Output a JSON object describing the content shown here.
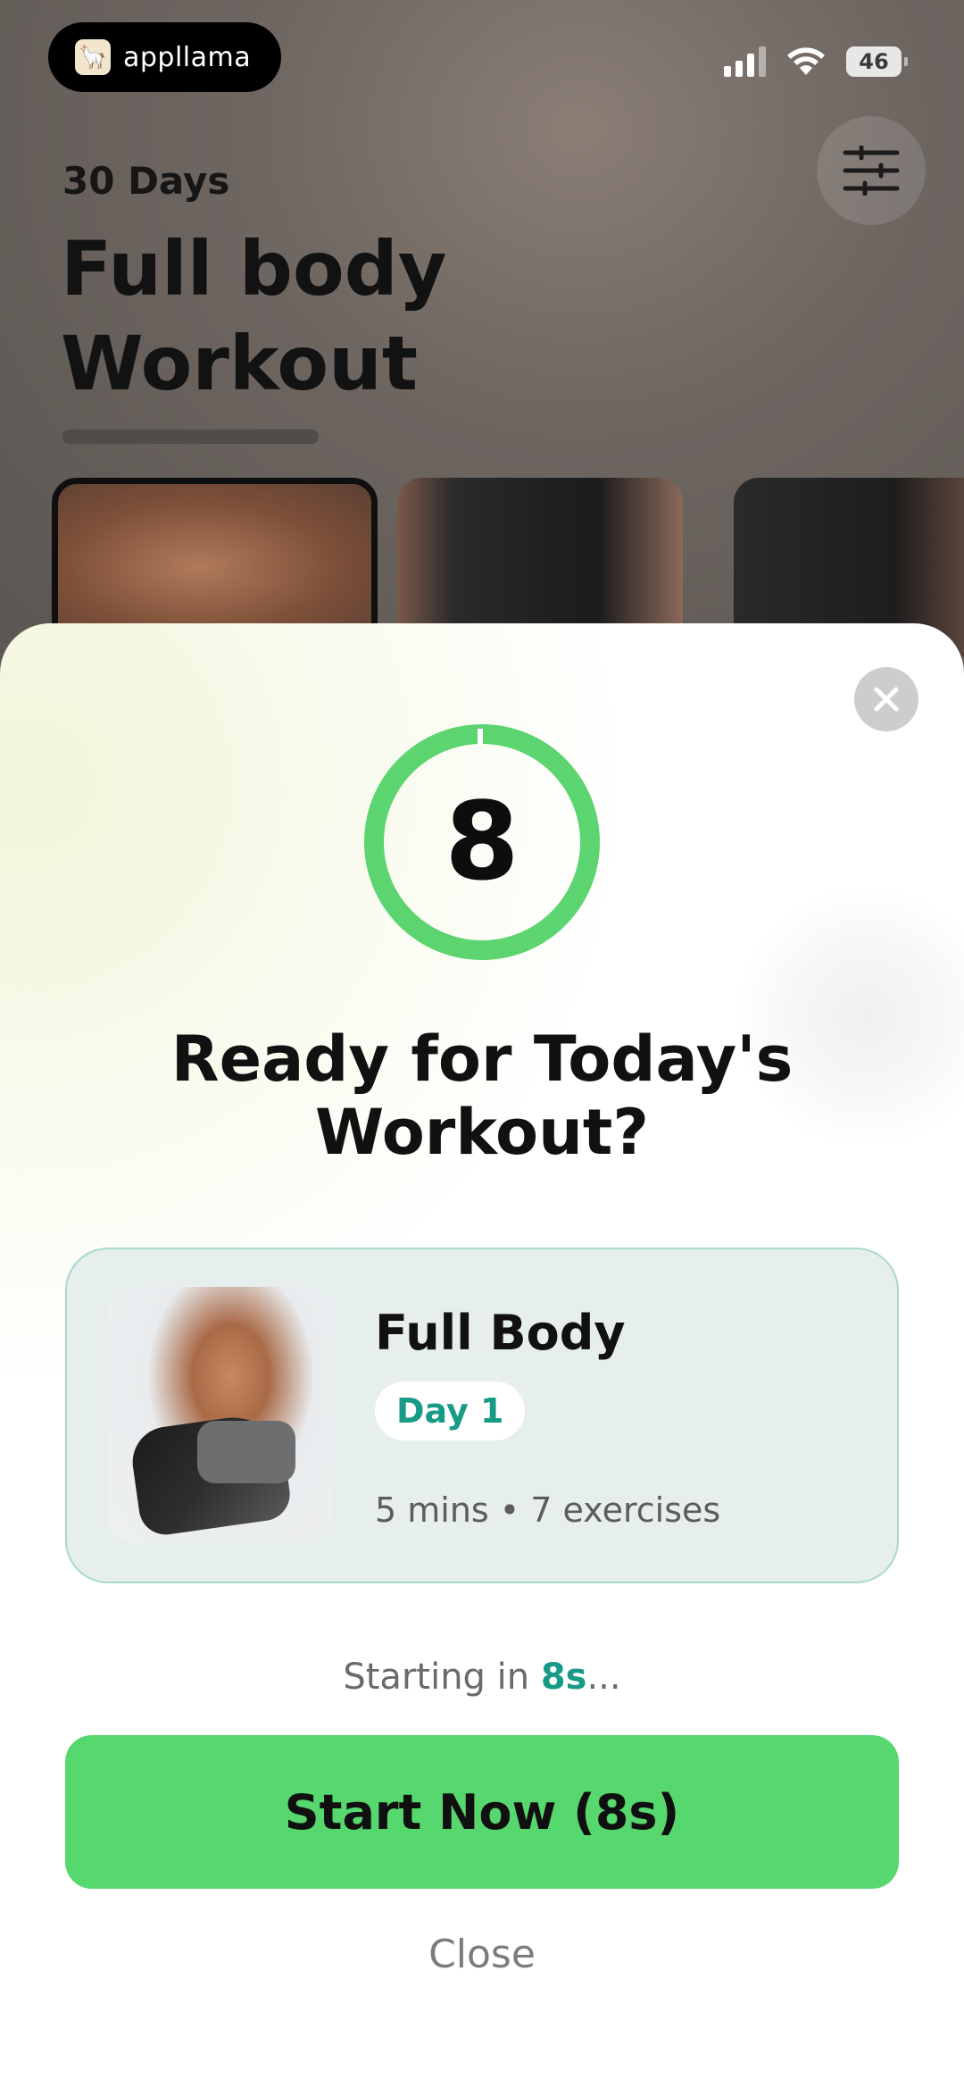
{
  "status_bar": {
    "app_pill_label": "appllama",
    "battery": "46"
  },
  "background_screen": {
    "eyebrow": "30 Days",
    "title_line1": "Full body",
    "title_line2": "Workout",
    "icons": [
      "filter-sliders-icon"
    ]
  },
  "modal": {
    "countdown": "8",
    "title_line1": "Ready for Today's",
    "title_line2": "Workout?",
    "workout_card": {
      "name": "Full Body",
      "day_badge": "Day 1",
      "meta": "5 mins • 7 exercises"
    },
    "starting_prefix": "Starting in ",
    "starting_value": "8s",
    "starting_suffix": "...",
    "start_button": "Start Now (8s)",
    "close_link": "Close",
    "accent_color": "#57d86f",
    "teal_color": "#179a86"
  }
}
